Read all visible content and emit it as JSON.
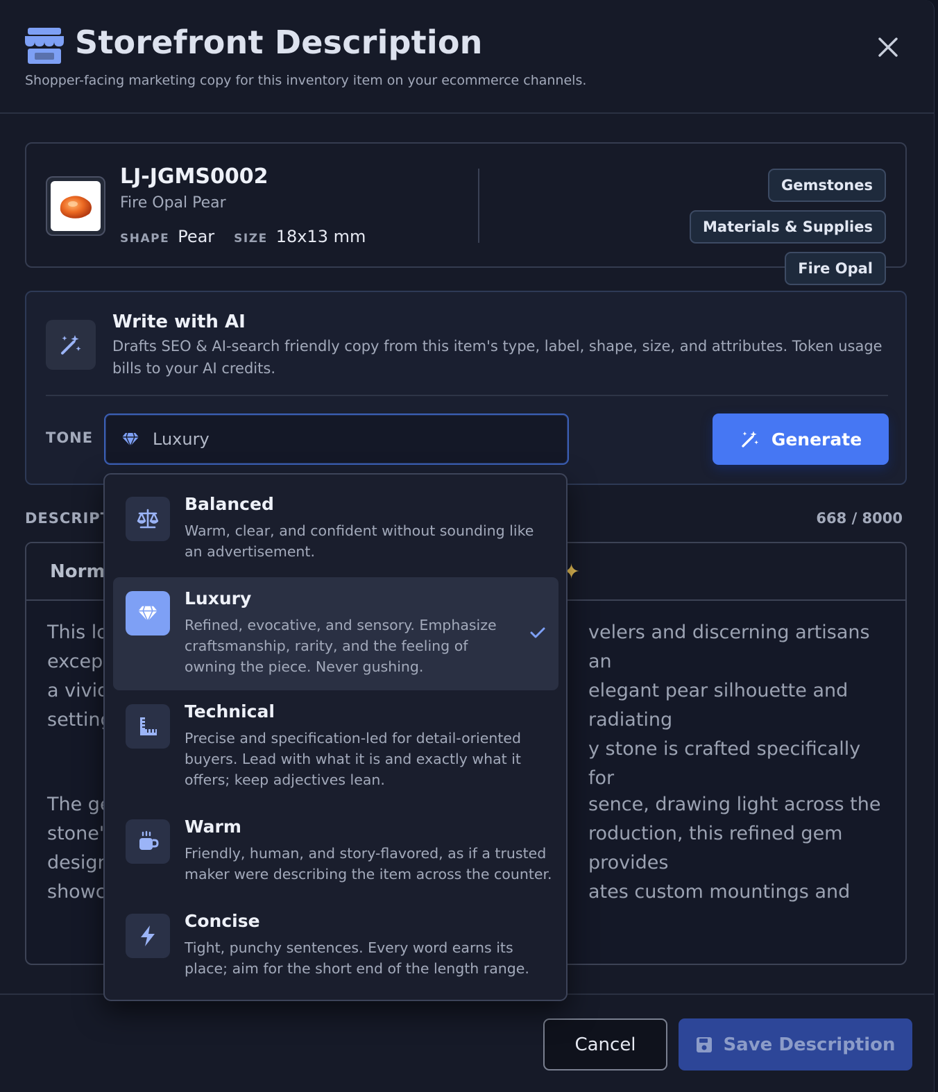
{
  "header": {
    "title": "Storefront Description",
    "subtitle": "Shopper-facing marketing copy for this inventory item on your ecommerce channels.",
    "close_icon": "close-icon",
    "store_icon": "storefront-icon"
  },
  "item": {
    "sku": "LJ-JGMS0002",
    "name": "Fire Opal Pear",
    "attributes": [
      {
        "key": "SHAPE",
        "value": "Pear"
      },
      {
        "key": "SIZE",
        "value": "18x13 mm"
      }
    ],
    "tags": [
      "Gemstones",
      "Materials & Supplies",
      "Fire Opal"
    ]
  },
  "ai": {
    "title": "Write with AI",
    "description": "Drafts SEO & AI-search friendly copy from this item's type, label, shape, size, and attributes. Token usage bills to your AI credits.",
    "tone_label": "TONE",
    "tone_value": "Luxury",
    "generate_label": "Generate"
  },
  "description": {
    "label": "DESCRIPT",
    "char_count": "668 / 8000",
    "toolbar_format": "Norma",
    "paragraphs": [
      {
        "lines": [
          "This lo",
          "except",
          "a vivid",
          "setting"
        ],
        "right_lines": [
          "velers and discerning artisans an",
          "elegant pear silhouette and radiating",
          "y stone is crafted specifically for",
          ""
        ]
      },
      {
        "lines": [
          "The ge",
          "stone's",
          "design",
          "showc"
        ],
        "right_lines": [
          "sence, drawing light across the",
          "roduction, this refined gem provides",
          "ates custom mountings and",
          ""
        ]
      }
    ]
  },
  "footer": {
    "cancel_label": "Cancel",
    "save_label": "Save Description"
  },
  "tone_options": [
    {
      "title": "Balanced",
      "description": "Warm, clear, and confident without sounding like an advertisement.",
      "icon": "scale-icon",
      "selected": false
    },
    {
      "title": "Luxury",
      "description": "Refined, evocative, and sensory. Emphasize craftsmanship, rarity, and the feeling of owning the piece. Never gushing.",
      "icon": "diamond-icon",
      "selected": true
    },
    {
      "title": "Technical",
      "description": "Precise and specification-led for detail-oriented buyers. Lead with what it is and exactly what it offers; keep adjectives lean.",
      "icon": "ruler-icon",
      "selected": false
    },
    {
      "title": "Warm",
      "description": "Friendly, human, and story-flavored, as if a trusted maker were describing the item across the counter.",
      "icon": "mug-icon",
      "selected": false
    },
    {
      "title": "Concise",
      "description": "Tight, punchy sentences. Every word earns its place; aim for the short end of the length range.",
      "icon": "bolt-icon",
      "selected": false
    }
  ],
  "colors": {
    "accent": "#4677f3",
    "background": "#161a28",
    "selected_option": "#2a3043",
    "sparkle": "#e7bf55"
  }
}
